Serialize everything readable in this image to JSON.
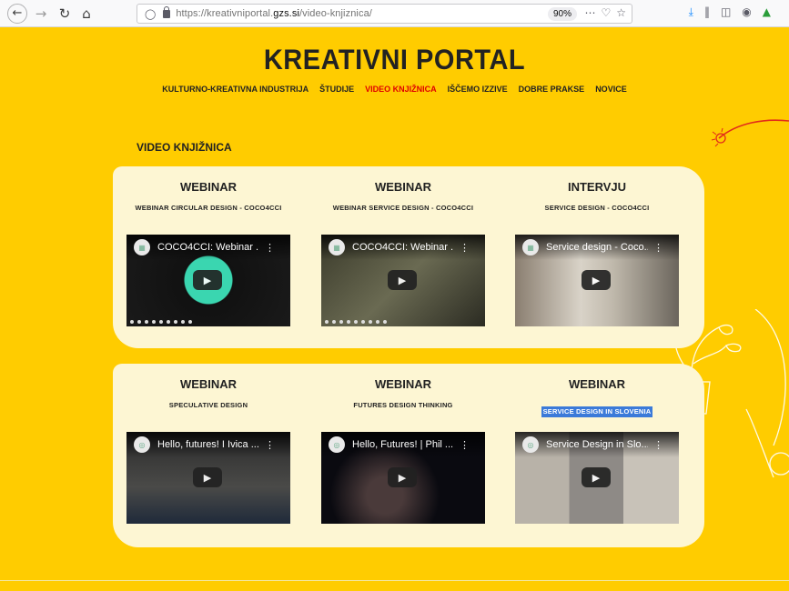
{
  "browser": {
    "url_prefix": "https://kreativniportal.",
    "url_domain": "gzs.si",
    "url_path": "/video-knjiznica/",
    "zoom": "90%",
    "back_icon": "back-arrow-icon",
    "forward_icon": "forward-arrow-icon",
    "reload_icon": "reload-icon",
    "home_icon": "home-icon"
  },
  "site": {
    "title": "KREATIVNI PORTAL",
    "nav": [
      {
        "label": "KULTURNO-KREATIVNA INDUSTRIJA"
      },
      {
        "label": "ŠTUDIJE"
      },
      {
        "label": "VIDEO KNJIŽNICA"
      },
      {
        "label": "IŠČEMO IZZIVE"
      },
      {
        "label": "DOBRE PRAKSE"
      },
      {
        "label": "NOVICE"
      }
    ],
    "section_title": "VIDEO KNJIŽNICA"
  },
  "colors": {
    "background": "#ffcc00",
    "panel": "#fdf6d3",
    "active_nav": "#e00000",
    "selection": "#3b7ad9"
  },
  "cards": [
    {
      "category": "WEBINAR",
      "title": "WEBINAR CIRCULAR DESIGN - COCO4CCI",
      "video_title": "COCO4CCI: Webinar ..."
    },
    {
      "category": "WEBINAR",
      "title": "WEBINAR SERVICE DESIGN - COCO4CCI",
      "video_title": "COCO4CCI: Webinar ..."
    },
    {
      "category": "INTERVJU",
      "title": "SERVICE DESIGN - COCO4CCI",
      "video_title": "Service design - Coco..."
    },
    {
      "category": "WEBINAR",
      "title": "SPECULATIVE DESIGN",
      "video_title": "Hello, futures! I Ivica ..."
    },
    {
      "category": "WEBINAR",
      "title": "FUTURES DESIGN THINKING",
      "video_title": "Hello, Futures! | Phil ..."
    },
    {
      "category": "WEBINAR",
      "title": "SERVICE DESIGN IN SLOVENIA",
      "video_title": "Service Design in Slo..."
    }
  ]
}
